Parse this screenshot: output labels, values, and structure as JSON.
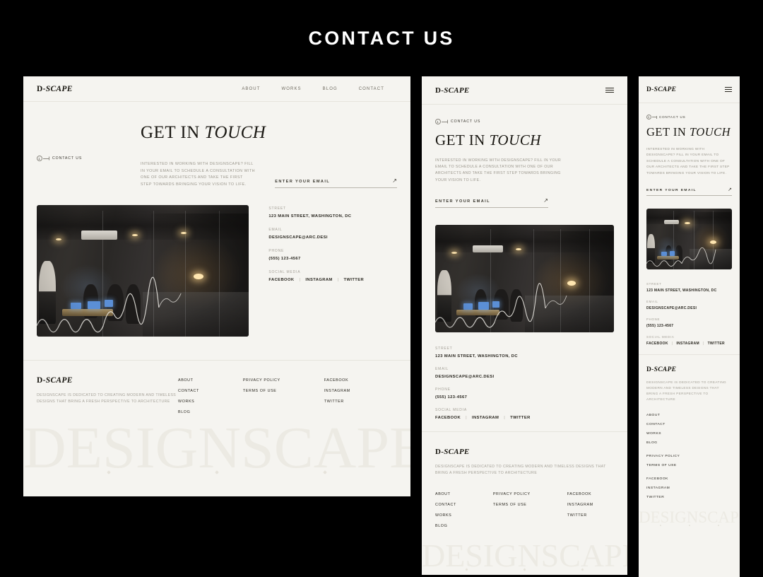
{
  "page": {
    "title": "CONTACT US",
    "background_color": "#000000",
    "frame_background": "#f5f4f0"
  },
  "brand": {
    "logo_prefix": "D-",
    "logo_suffix": "SCAPE",
    "wordmark": "DESIGNSCAPE"
  },
  "nav": {
    "items": [
      {
        "label": "ABOUT"
      },
      {
        "label": "WORKS"
      },
      {
        "label": "BLOG"
      },
      {
        "label": "CONTACT"
      }
    ],
    "menu_icon": "hamburger-icon"
  },
  "hero": {
    "eyebrow_number": "1",
    "eyebrow_label": "CONTACT US",
    "headline_regular": "GET IN ",
    "headline_italic": "TOUCH",
    "body": "INTERESTED IN WORKING WITH DESIGNSCAPE? FILL IN YOUR EMAIL TO SCHEDULE A CONSULTATION WITH ONE OF OUR ARCHITECTS AND TAKE THE FIRST STEP TOWARDS BRINGING YOUR VISION TO LIFE."
  },
  "email_form": {
    "placeholder": "ENTER YOUR EMAIL",
    "value": "",
    "submit_icon": "arrow-up-right-icon",
    "submit_glyph": "↗"
  },
  "photo": {
    "alt": "dark office interior with people working at a table and glass partitions"
  },
  "contact_info": [
    {
      "label": "STREET",
      "value": "123 MAIN STREET, WASHINGTON, DC"
    },
    {
      "label": "EMAIL",
      "value": "DESIGNSCAPE@ARC.DESI"
    },
    {
      "label": "PHONE",
      "value": "(555) 123-4567"
    }
  ],
  "social": {
    "label": "SOCIAL MEDIA",
    "separator": "|",
    "items": [
      {
        "label": "FACEBOOK"
      },
      {
        "label": "INSTAGRAM"
      },
      {
        "label": "TWITTER"
      }
    ]
  },
  "footer": {
    "description": "DESIGNSCAPE IS DEDICATED TO CREATING MODERN AND TIMELESS DESIGNS THAT BRING A FRESH PERSPECTIVE TO ARCHITECTURE",
    "columns": [
      {
        "links": [
          {
            "label": "ABOUT"
          },
          {
            "label": "CONTACT"
          },
          {
            "label": "WORKS"
          },
          {
            "label": "BLOG"
          }
        ]
      },
      {
        "links": [
          {
            "label": "PRIVACY POLICY"
          },
          {
            "label": "TERMS OF USE"
          }
        ]
      },
      {
        "links": [
          {
            "label": "FACEBOOK"
          },
          {
            "label": "INSTAGRAM"
          },
          {
            "label": "TWITTER"
          }
        ]
      }
    ]
  },
  "colors": {
    "ink": "#2a2720",
    "muted": "#a5a198",
    "rule": "#e6e4dd",
    "watermark": "#eceae3"
  }
}
